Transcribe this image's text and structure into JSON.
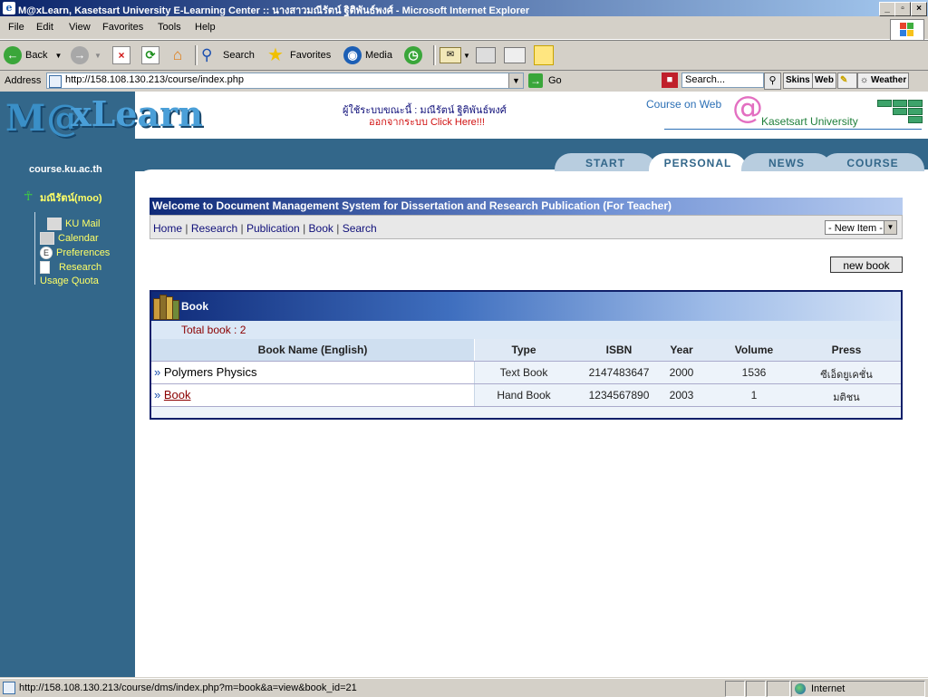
{
  "window": {
    "title": "M@xLearn, Kasetsart University E-Learning Center :: นางสาวมณีรัตน์ ฐิติพันธ์พงศ์ - Microsoft Internet Explorer",
    "controls": [
      "_",
      "▫",
      "×"
    ]
  },
  "menu": [
    "File",
    "Edit",
    "View",
    "Favorites",
    "Tools",
    "Help"
  ],
  "toolbar": {
    "back": "Back",
    "search": "Search",
    "favorites": "Favorites",
    "media": "Media"
  },
  "address": {
    "label": "Address",
    "url": "http://158.108.130.213/course/index.php",
    "go": "Go",
    "search_placeholder": "Search...",
    "skins": "Skins",
    "web": "Web",
    "weather": "Weather"
  },
  "header": {
    "logo": "M@xLearn",
    "logo_m": "M@",
    "logo_x": "xLearn",
    "domain": "course.ku.ac.th",
    "user_line": "ผู้ใช้ระบบขณะนี้ : มณีรัตน์ ฐิติพันธ์พงศ์",
    "logout_line": "ออกจากระบบ Click Here!!!",
    "cow_title": "Course on Web",
    "cow_at": "@",
    "cow_ku": "Kasetsart University"
  },
  "tabs": [
    {
      "label": "START",
      "active": false
    },
    {
      "label": "PERSONAL",
      "active": true
    },
    {
      "label": "NEWS",
      "active": false
    },
    {
      "label": "COURSE",
      "active": false
    }
  ],
  "sidebar": {
    "user": "มณีรัตน์(moo)",
    "items": [
      {
        "label": "KU Mail"
      },
      {
        "label": "Calendar"
      },
      {
        "label": "Preferences"
      },
      {
        "label": "Research"
      },
      {
        "label": "Usage Quota"
      }
    ]
  },
  "content": {
    "welcome": "Welcome to Document Management System for Dissertation and Research Publication (For Teacher)",
    "subnav": [
      "Home",
      "Research",
      "Publication",
      "Book",
      "Search"
    ],
    "new_item_select": "- New Item -",
    "new_book_button": "new book",
    "table": {
      "title": "Book",
      "total": "Total book : 2",
      "columns": [
        "Book Name (English)",
        "Type",
        "ISBN",
        "Year",
        "Volume",
        "Press"
      ],
      "rows": [
        {
          "name": "Polymers Physics",
          "type": "Text Book",
          "isbn": "2147483647",
          "year": "2000",
          "volume": "1536",
          "press": "ซีเอ็ดยูเคชั่น",
          "linked": false
        },
        {
          "name": "Book",
          "type": "Hand Book",
          "isbn": "1234567890",
          "year": "2003",
          "volume": "1",
          "press": "มติชน",
          "linked": true
        }
      ]
    }
  },
  "status": {
    "text": "http://158.108.130.213/course/dms/index.php?m=book&a=view&book_id=21",
    "zone": "Internet"
  }
}
